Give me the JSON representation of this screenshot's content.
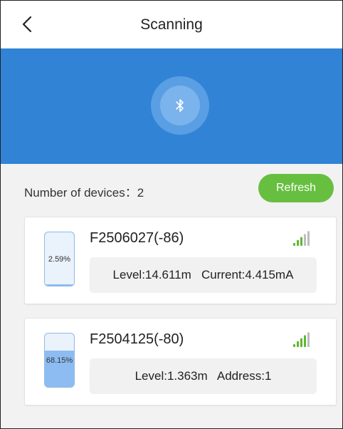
{
  "header": {
    "title": "Scanning",
    "back_icon": "chevron-left-icon"
  },
  "hero": {
    "icon": "bluetooth-icon",
    "bg_color": "#3183d6"
  },
  "devices_summary": {
    "label": "Number of devices：2",
    "refresh_label": "Refresh"
  },
  "devices": [
    {
      "name": "F2506027(-86)",
      "fill_percent_label": "2.59%",
      "fill_fraction": 0.0259,
      "info": "Level:14.611m   Current:4.415mA",
      "signal_bars_active": 3,
      "signal_bars_total": 5
    },
    {
      "name": "F2504125(-80)",
      "fill_percent_label": "68.15%",
      "fill_fraction": 0.6815,
      "info": "Level:1.363m   Address:1",
      "signal_bars_active": 4,
      "signal_bars_total": 5
    }
  ],
  "colors": {
    "accent_green": "#67bf3f",
    "signal_active": "#5cb82f",
    "signal_inactive": "#bdbdbd"
  }
}
